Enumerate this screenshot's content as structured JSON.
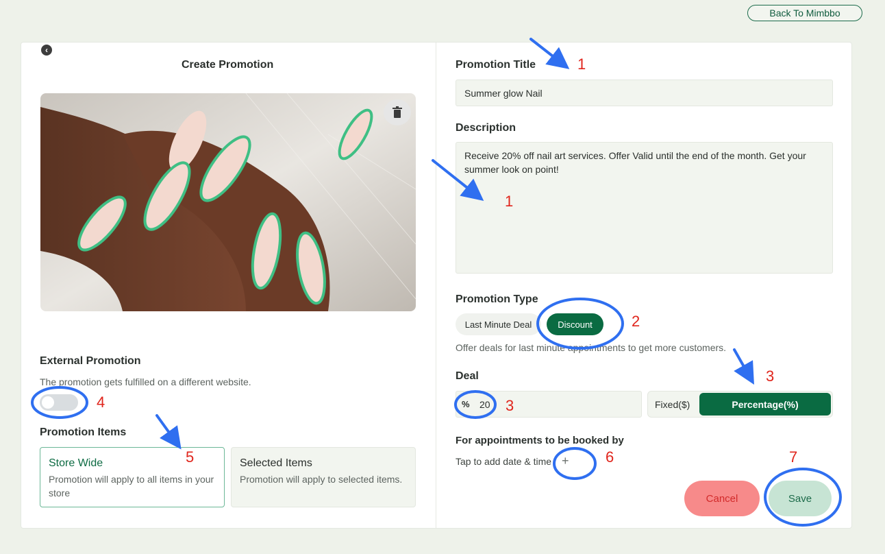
{
  "header": {
    "back_label": "Back To Mimbbo"
  },
  "left": {
    "title": "Create Promotion",
    "external": {
      "label": "External Promotion",
      "desc": "The promotion gets fulfilled on a different website.",
      "enabled": false
    },
    "items_label": "Promotion Items",
    "store_wide": {
      "title": "Store Wide",
      "desc": "Promotion will apply to all items in your store"
    },
    "selected_items": {
      "title": "Selected Items",
      "desc": "Promotion will apply to selected items."
    }
  },
  "right": {
    "title_label": "Promotion Title",
    "title_value": "Summer glow Nail",
    "desc_label": "Description",
    "desc_value": "Receive 20% off nail art services. Offer Valid until the end of  the month. Get your summer look on point!",
    "type_label": "Promotion Type",
    "types": [
      "Last Minute Deal",
      "Discount"
    ],
    "type_hint": "Offer deals for last minute appointments to get more customers.",
    "deal_label": "Deal",
    "deal_prefix": "%",
    "deal_value": "20",
    "deal_fixed": "Fixed($)",
    "deal_percent": "Percentage(%)",
    "booking_label": "For appointments to be booked by",
    "booking_hint": "Tap to add date & time",
    "add_symbol": "+",
    "cancel": "Cancel",
    "save": "Save"
  },
  "annotations": [
    "1",
    "1",
    "2",
    "3",
    "3",
    "4",
    "5",
    "6",
    "7"
  ],
  "colors": {
    "brand": "#0a6b42",
    "annotation": "#2f6ff0",
    "annotation_number": "#e0251c",
    "cancel": "#f78a8a",
    "save": "#c7e4d4"
  }
}
